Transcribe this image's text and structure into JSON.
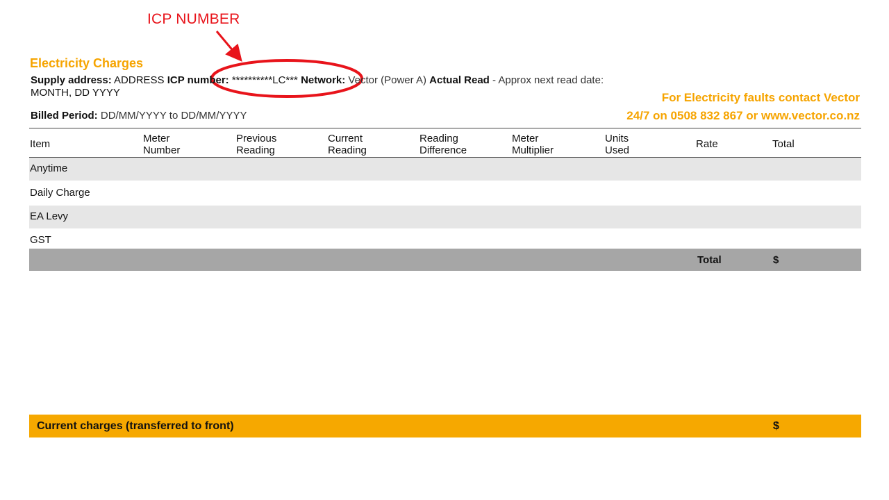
{
  "annotation": {
    "label": "ICP NUMBER",
    "color": "#e8141b"
  },
  "header": {
    "title": "Electricity Charges",
    "supply_label": "Supply address:",
    "supply_value": "ADDRESS",
    "icp_label": "ICP number:",
    "icp_value": "**********LC***",
    "network_label": "Network:",
    "network_value": "Vector (Power A)",
    "read_type": "Actual Read",
    "next_read_text": " - Approx next read date: ",
    "next_read_date": "MONTH, DD YYYY",
    "billed_label": "Billed Period:",
    "billed_from": "DD/MM/YYYY",
    "billed_to_word": "to",
    "billed_to": "DD/MM/YYYY",
    "contact_line1": "For Electricity faults contact Vector",
    "contact_line2": "24/7 on 0508 832 867 or www.vector.co.nz"
  },
  "table": {
    "columns": [
      "Item",
      "Meter Number",
      "Previous Reading",
      "Current Reading",
      "Reading Difference",
      "Meter Multiplier",
      "Units Used",
      "Rate",
      "Total"
    ],
    "column_lines": [
      [
        "Item"
      ],
      [
        "Meter",
        "Number"
      ],
      [
        "Previous",
        "Reading"
      ],
      [
        "Current",
        "Reading"
      ],
      [
        "Reading",
        "Difference"
      ],
      [
        "Meter",
        "Multiplier"
      ],
      [
        "Units",
        "Used"
      ],
      [
        "Rate"
      ],
      [
        "Total"
      ]
    ],
    "rows": [
      "Anytime",
      "Daily Charge",
      "EA Levy",
      "GST"
    ],
    "total_label": "Total",
    "total_value": "$"
  },
  "footer": {
    "current_label": "Current charges (transferred to front)",
    "current_value": "$"
  },
  "colors": {
    "accent": "#f6a400",
    "bar": "#f6a800",
    "stripe": "#e6e6e6",
    "total_bg": "#a6a6a6",
    "annotation": "#e8141b"
  }
}
